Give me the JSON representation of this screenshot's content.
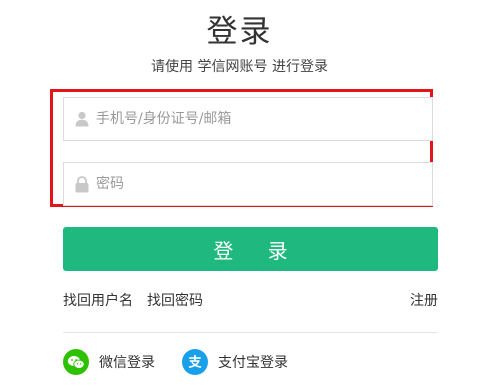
{
  "header": {
    "title": "登录",
    "subtitle": "请使用 学信网账号 进行登录"
  },
  "form": {
    "username": {
      "placeholder": "手机号/身份证号/邮箱",
      "value": "",
      "icon": "user-icon"
    },
    "password": {
      "placeholder": "密码",
      "value": "",
      "icon": "lock-icon"
    },
    "login_label": "登 录",
    "highlight_color": "#e4141b"
  },
  "links": {
    "recover_username": "找回用户名",
    "recover_password": "找回密码",
    "register": "注册"
  },
  "social": {
    "wechat": {
      "label": "微信登录",
      "icon": "wechat-icon",
      "color": "#2dc100"
    },
    "alipay": {
      "label": "支付宝登录",
      "icon": "alipay-icon",
      "color": "#1aa0e8"
    }
  },
  "colors": {
    "accent": "#1fb87f"
  }
}
